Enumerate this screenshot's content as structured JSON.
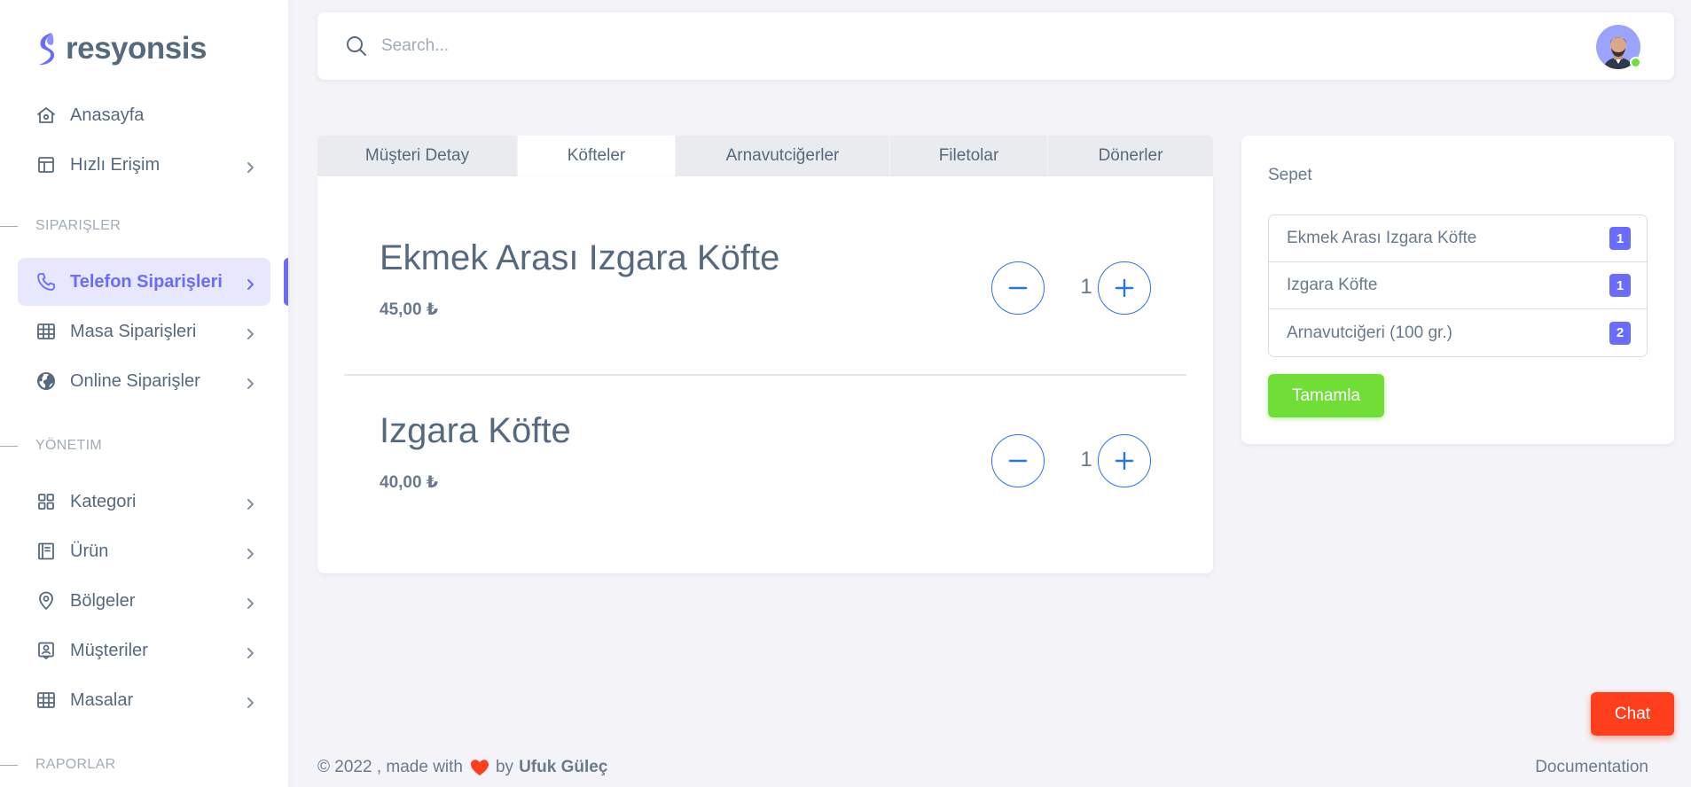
{
  "brand": {
    "name": "resyonsis"
  },
  "sidebar": {
    "items": [
      {
        "label": "Anasayfa",
        "icon": "home-icon"
      },
      {
        "label": "Hızlı Erişim",
        "icon": "layout-icon"
      },
      {
        "label": "Telefon Siparişleri",
        "icon": "phone-icon",
        "active": true
      },
      {
        "label": "Masa Siparişleri",
        "icon": "table-icon"
      },
      {
        "label": "Online Siparişler",
        "icon": "globe-icon"
      },
      {
        "label": "Kategori",
        "icon": "grid-icon"
      },
      {
        "label": "Ürün",
        "icon": "book-icon"
      },
      {
        "label": "Bölgeler",
        "icon": "map-pin-icon"
      },
      {
        "label": "Müşteriler",
        "icon": "user-badge-icon"
      },
      {
        "label": "Masalar",
        "icon": "table-icon"
      }
    ],
    "headers": [
      "SIPARIŞLER",
      "YÖNETIM",
      "RAPORLAR"
    ]
  },
  "search": {
    "placeholder": "Search...",
    "value": ""
  },
  "tabs": [
    "Müşteri Detay",
    "Köfteler",
    "Arnavutciğerler",
    "Filetolar",
    "Dönerler"
  ],
  "active_tab": "Köfteler",
  "products": [
    {
      "name": "Ekmek Arası Izgara Köfte",
      "price": "45,00 ₺",
      "quantity": "1"
    },
    {
      "name": "Izgara Köfte",
      "price": "40,00 ₺",
      "quantity": "1"
    }
  ],
  "cart": {
    "title": "Sepet",
    "items": [
      {
        "name": "Ekmek Arası Izgara Köfte",
        "count": "1"
      },
      {
        "name": "Izgara Köfte",
        "count": "1"
      },
      {
        "name": "Arnavutciğeri (100 gr.)",
        "count": "2"
      }
    ],
    "complete_label": "Tamamla"
  },
  "footer": {
    "prefix": "© 2022 , made with",
    "by": "by",
    "author": "Ufuk Güleç",
    "documentation": "Documentation"
  },
  "chat_label": "Chat",
  "colors": {
    "primary": "#696cff",
    "success": "#71dd37",
    "danger": "#ff3e1d",
    "qty_button": "#2b74e8",
    "text": "#566a7f"
  }
}
